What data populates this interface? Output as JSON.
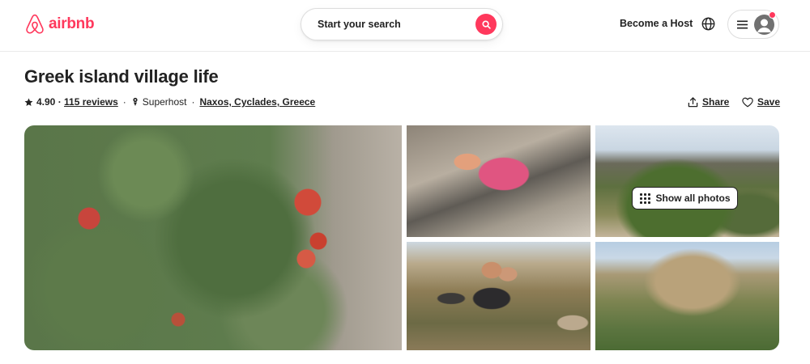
{
  "header": {
    "logo_text": "airbnb",
    "search_label": "Start your search",
    "host_link": "Become a Host"
  },
  "listing": {
    "title": "Greek island village life",
    "rating": "4.90",
    "reviews": "115 reviews",
    "superhost": "Superhost",
    "location": "Naxos, Cyclades, Greece"
  },
  "actions": {
    "share": "Share",
    "save": "Save"
  },
  "gallery": {
    "show_all": "Show all photos"
  },
  "colors": {
    "brand": "#FF385C",
    "text": "#222222",
    "border": "#DDDDDD"
  },
  "icons": [
    "airbnb-logo-icon",
    "search-icon",
    "globe-icon",
    "menu-icon",
    "avatar-icon",
    "star-icon",
    "superhost-icon",
    "share-icon",
    "heart-icon",
    "grid-icon"
  ]
}
